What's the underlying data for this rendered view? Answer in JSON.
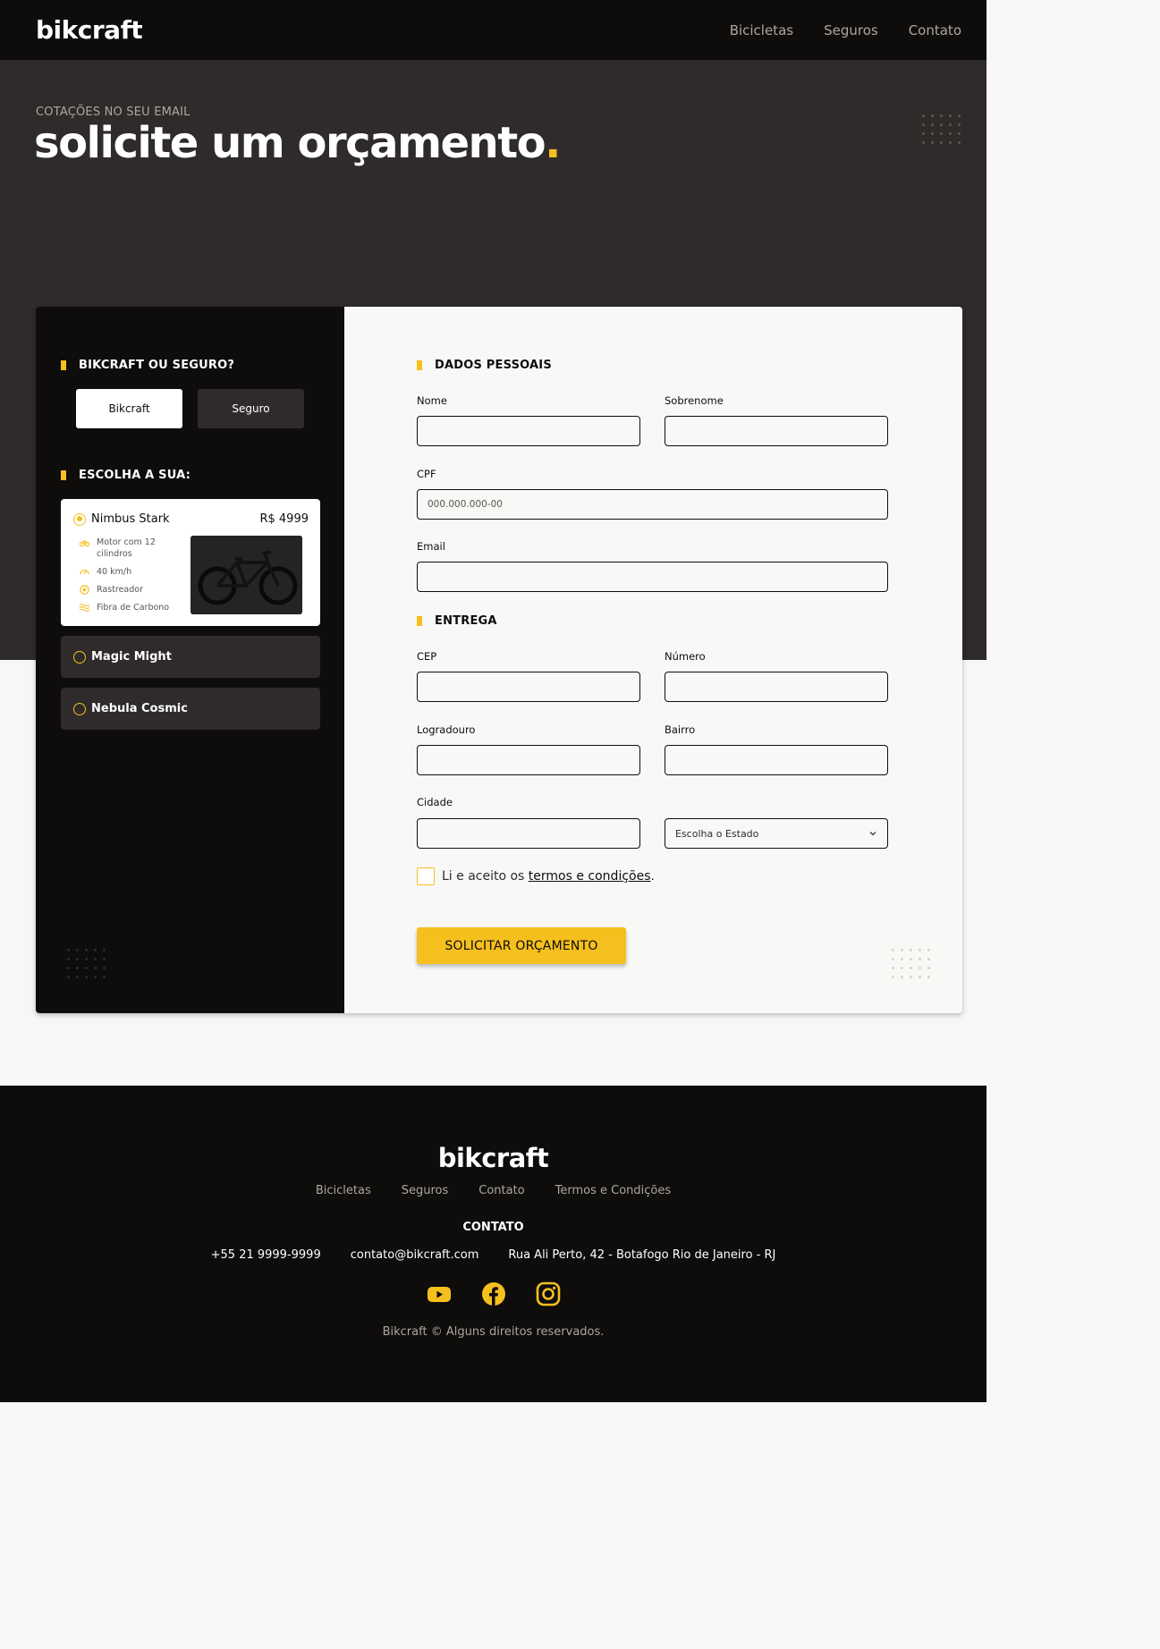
{
  "header": {
    "logo": "bikcraft",
    "nav": [
      "Bicicletas",
      "Seguros",
      "Contato"
    ]
  },
  "hero": {
    "subtitle": "COTAÇÕES NO SEU EMAIL",
    "title": "solicite um orçamento",
    "title_dot": "."
  },
  "sidebar": {
    "choice_title": "BIKCRAFT OU SEGURO?",
    "toggle": {
      "bikcraft": "Bikcraft",
      "seguro": "Seguro",
      "selected": "Bikcraft"
    },
    "bikes_title": "ESCOLHA A SUA:",
    "selected_bike": {
      "name": "Nimbus Stark",
      "price": "R$ 4999",
      "features": [
        {
          "icon": "engine-icon",
          "text": "Motor com 12 cilindros"
        },
        {
          "icon": "speedometer-icon",
          "text": "40 km/h"
        },
        {
          "icon": "tracker-icon",
          "text": "Rastreador"
        },
        {
          "icon": "carbon-fiber-icon",
          "text": "Fibra de Carbono"
        }
      ]
    },
    "other_bikes": [
      "Magic Might",
      "Nebula Cosmic"
    ]
  },
  "form": {
    "personal_title": "DADOS PESSOAIS",
    "labels": {
      "nome": "Nome",
      "sobrenome": "Sobrenome",
      "cpf": "CPF",
      "email": "Email"
    },
    "placeholders": {
      "cpf": "000.000.000-00"
    },
    "delivery_title": "ENTREGA",
    "delivery_labels": {
      "cep": "CEP",
      "numero": "Número",
      "logradouro": "Logradouro",
      "bairro": "Bairro",
      "cidade": "Cidade"
    },
    "estado_select": "Escolha o Estado",
    "terms_prefix": "Li e aceito os ",
    "terms_link": "termos e condições",
    "terms_suffix": ".",
    "submit": "SOLICITAR ORÇAMENTO"
  },
  "footer": {
    "logo": "bikcraft",
    "nav": [
      "Bicicletas",
      "Seguros",
      "Contato",
      "Termos e Condições"
    ],
    "contact_heading": "CONTATO",
    "phone": "+55 21 9999-9999",
    "email": "contato@bikcraft.com",
    "address": "Rua Ali Perto, 42 - Botafogo Rio de Janeiro - RJ",
    "social": [
      "youtube-icon",
      "facebook-icon",
      "instagram-icon"
    ],
    "copyright": "Bikcraft © Alguns direitos reservados."
  },
  "colors": {
    "accent": "#f5bf1e",
    "dark": "#0e0d0c",
    "hero_bg": "#2e2b2a",
    "muted": "#aba7a2"
  }
}
